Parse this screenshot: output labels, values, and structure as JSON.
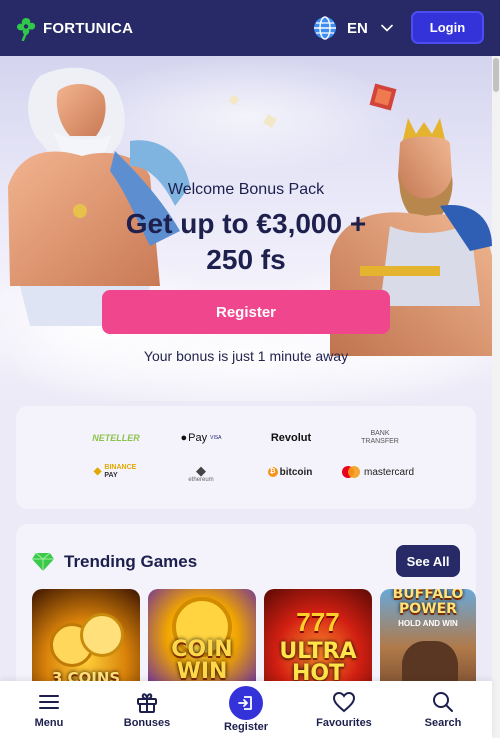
{
  "header": {
    "brand": "FORTUNICA",
    "language": "EN",
    "login_label": "Login",
    "icons": [
      "clover-logo-icon",
      "globe-icon",
      "chevron-down-icon"
    ]
  },
  "hero": {
    "subtitle": "Welcome Bonus Pack",
    "title_line1": "Get up to €3,000 +",
    "title_line2": "250 fs",
    "register_label": "Register",
    "note": "Your bonus is just 1 minute away"
  },
  "payments": {
    "methods": [
      "NETELLER",
      "Pay",
      "VISA",
      "Revolut",
      "BANK",
      "TRANSFER",
      "BINANCE",
      "PAY",
      "ethereum",
      "bitcoin",
      "mastercard"
    ]
  },
  "trending": {
    "title": "Trending Games",
    "see_all_label": "See All",
    "games": [
      {
        "name": "3 COINS"
      },
      {
        "name": "COIN WIN"
      },
      {
        "name": "ULTRA HOT"
      },
      {
        "name": "BUFFALO POWER"
      }
    ],
    "game_subtitle": "HOLD AND WIN"
  },
  "bottom_nav": {
    "items": [
      {
        "label": "Menu",
        "icon": "hamburger-menu-icon"
      },
      {
        "label": "Bonuses",
        "icon": "gift-icon"
      },
      {
        "label": "Register",
        "icon": "register-icon"
      },
      {
        "label": "Favourites",
        "icon": "heart-icon"
      },
      {
        "label": "Search",
        "icon": "search-icon"
      }
    ]
  },
  "colors": {
    "header_bg": "#272a66",
    "login_bg": "#3433d9",
    "register_bg": "#f0468d",
    "page_bg": "#eceaf7"
  }
}
